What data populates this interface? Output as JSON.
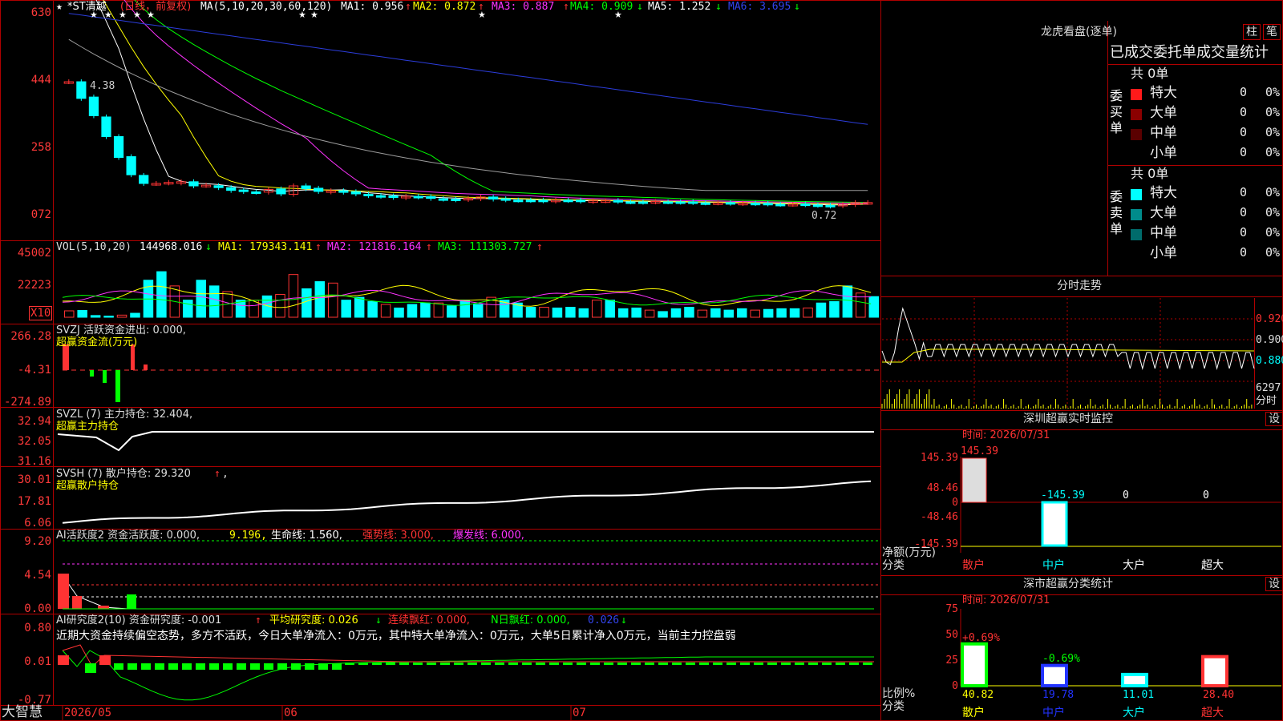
{
  "brand": "大智慧",
  "colors": {
    "up": "#ff3333",
    "down": "#00ffff",
    "white": "#ffffff",
    "yellow": "#ffff00",
    "magenta": "#ff33ff",
    "green": "#00ff00",
    "blue": "#2c3ddb",
    "grey": "#9c9c9c",
    "frame": "#b00000",
    "grid": "#550000"
  },
  "main": {
    "stock_name": "*ST清越",
    "star_prefix": "★",
    "period_label": "(日线，前复权)",
    "ma_header": "MA(5,10,20,30,60,120)",
    "ma1": "MA1: 0.956",
    "ma2": "MA2: 0.872",
    "ma3": "MA3: 0.887",
    "ma4": "MA4: 0.909",
    "ma5": "MA5: 1.252",
    "ma6": "MA6: 3.695",
    "ma1_arrow": "↑",
    "ma2_arrow": "↑",
    "ma3_arrow": "↑",
    "ma4_arrow": "↓",
    "ma5_arrow": "↓",
    "ma6_arrow": "↓",
    "yaxis": [
      "630",
      "444",
      "258",
      "072"
    ],
    "high_note": "4.38",
    "low_note": "0.72"
  },
  "volume": {
    "header": "VOL(5,10,20)",
    "value": "144968.016",
    "value_arrow": "↓",
    "ma1": "MA1: 179343.141",
    "ma1_arrow": "↑",
    "ma2": "MA2: 121816.164",
    "ma2_arrow": "↑",
    "ma3": "MA3: 111303.727",
    "ma3_arrow": "↑",
    "yaxis": [
      "45002",
      "22223"
    ],
    "multiplier": "X10"
  },
  "svzj": {
    "header": "SVZJ  活跃资金进出: 0.000,",
    "sub": "超赢资金流(万元)",
    "yaxis": [
      "266.28",
      "-4.31",
      "-274.89"
    ]
  },
  "svzl": {
    "header": "SVZL (7) 主力持仓: 32.404,",
    "sub": "超赢主力持仓",
    "yaxis": [
      "32.94",
      "32.05",
      "31.16"
    ]
  },
  "svsh": {
    "header": "SVSH (7) 散户持仓: 29.320",
    "header_arrow": "↑",
    "header_end": ",",
    "sub": "超赢散户持仓",
    "yaxis": [
      "30.01",
      "17.81",
      "6.06"
    ]
  },
  "ai_active": {
    "header": "AI活跃度2 资金活跃度: 0.000,",
    "v1": "9.196,",
    "v2": "生命线: 1.560,",
    "v3": "强势线: 3.000,",
    "v4": "爆发线: 6.000,",
    "yaxis": [
      "9.20",
      "4.54",
      "0.00"
    ]
  },
  "ai_research": {
    "header": "AI研究度2(10) 资金研究度: -0.001",
    "header_arrow": "↑",
    "avg": "平均研究度: 0.026",
    "avg_arrow": "↓",
    "streak": "连续飘红: 0.000,",
    "nday": "N日飘红: 0.000,",
    "last": "0.026",
    "last_arrow": "↓",
    "summary": "近期大资金持续偏空态势，多方不活跃，今日大单净流入：0万元，其中特大单净流入：0万元，大单5日累计净入0万元，当前主力控盘弱",
    "yaxis": [
      "0.80",
      "0.01",
      "-0.77"
    ]
  },
  "xaxis": [
    "2026/05",
    "06",
    "07"
  ],
  "lhb": {
    "title": "龙虎看盘(逐单)",
    "btn_col": "柱",
    "btn_pen": "笔",
    "subtitle": "已成交委托单成交量统计",
    "buy_label": "委买单",
    "sell_label": "委卖单",
    "buy_total": "共 0单",
    "sell_total": "共 0单",
    "buy_rows": [
      {
        "label": "特大",
        "count": "0",
        "pct": "0%",
        "color": "#ff1a1a"
      },
      {
        "label": "大单",
        "count": "0",
        "pct": "0%",
        "color": "#8b0000"
      },
      {
        "label": "中单",
        "count": "0",
        "pct": "0%",
        "color": "#5a0000"
      },
      {
        "label": "小单",
        "count": "0",
        "pct": "0%",
        "color": ""
      }
    ],
    "sell_rows": [
      {
        "label": "特大",
        "count": "0",
        "pct": "0%",
        "color": "#00ffff"
      },
      {
        "label": "大单",
        "count": "0",
        "pct": "0%",
        "color": "#008b8b"
      },
      {
        "label": "中单",
        "count": "0",
        "pct": "0%",
        "color": "#006b6b"
      },
      {
        "label": "小单",
        "count": "0",
        "pct": "0%",
        "color": ""
      }
    ]
  },
  "intraday": {
    "title": "分时走势",
    "yaxis": [
      "0.920",
      "0.900",
      "0.880"
    ],
    "vol_top": "6297",
    "vol_unit": "分时"
  },
  "monitor": {
    "title": "深圳超赢实时监控",
    "set_btn": "设",
    "time": "时间: 2026/07/31",
    "yaxis": [
      "145.39",
      "48.46",
      "0",
      "-48.46",
      "-145.39"
    ],
    "bar_labels": [
      "145.39",
      "-145.39",
      "0",
      "0"
    ],
    "y_title": "净额(万元)",
    "x_title": "分类",
    "categories": [
      "散户",
      "中户",
      "大户",
      "超大"
    ]
  },
  "stats": {
    "title": "深市超赢分类统计",
    "set_btn": "设",
    "time": "时间: 2026/07/31",
    "yaxis": [
      "75",
      "50",
      "25",
      "0"
    ],
    "change_labels": [
      "+0.69%",
      "-0.69%"
    ],
    "values": [
      "40.82",
      "19.78",
      "11.01",
      "28.40"
    ],
    "y_title": "比例%",
    "x_title": "分类",
    "categories": [
      "散户",
      "中户",
      "大户",
      "超大"
    ]
  },
  "chart_data": [
    {
      "type": "candlestick",
      "title": "*ST清越 (日线，前复权)",
      "ylim": [
        0.72,
        6.3
      ],
      "yticks": [
        "630",
        "444",
        "258",
        "072"
      ],
      "x": [
        "2026/05",
        "06",
        "07"
      ],
      "closes_approx": [
        4.38,
        3.9,
        3.4,
        2.8,
        2.2,
        1.7,
        1.45,
        1.45,
        1.48,
        1.5,
        1.38,
        1.4,
        1.33,
        1.25,
        1.22,
        1.2,
        1.28,
        1.15,
        1.38,
        1.3,
        1.22,
        1.24,
        1.2,
        1.15,
        1.1,
        1.08,
        1.05,
        1.08,
        1.06,
        1.02,
        1.0,
        0.98,
        1.02,
        1.06,
        1.0,
        0.98,
        0.97,
        0.96,
        0.95,
        0.97,
        0.96,
        0.94,
        0.95,
        0.95,
        0.93,
        0.92,
        0.91,
        0.93,
        0.92,
        0.91,
        0.9,
        0.89,
        0.89,
        0.88,
        0.88,
        0.87,
        0.86,
        0.85,
        0.85,
        0.84,
        0.82,
        0.8,
        0.85,
        0.9,
        0.9
      ]
    },
    {
      "type": "bar",
      "title": "VOL(5,10,20)",
      "ylim": [
        0,
        45002
      ],
      "values_approx": [
        4500,
        4800,
        1200,
        800,
        1500,
        2800,
        26000,
        32000,
        22000,
        12000,
        26000,
        22000,
        18000,
        12000,
        12000,
        15000,
        16000,
        30000,
        20000,
        25000,
        24000,
        12000,
        14000,
        11000,
        9000,
        6500,
        9000,
        10000,
        10000,
        8000,
        12000,
        9000,
        14000,
        12000,
        10000,
        7000,
        7000,
        6500,
        7000,
        6000,
        12000,
        12000,
        6000,
        6500,
        5000,
        4000,
        6000,
        7000,
        5000,
        6000,
        5000,
        6000,
        5000,
        5500,
        6000,
        6000,
        6500,
        10000,
        11000,
        22000,
        17000,
        14500
      ]
    }
  ]
}
